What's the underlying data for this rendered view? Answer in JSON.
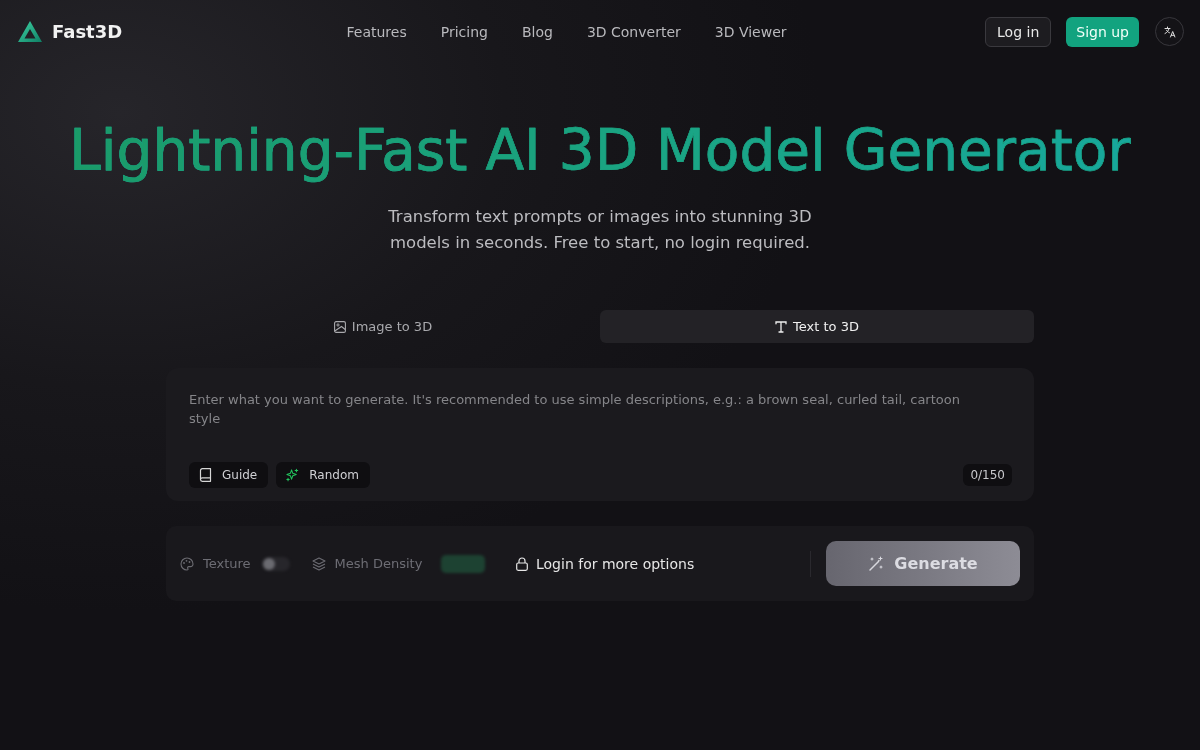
{
  "header": {
    "logo": "Fast3D",
    "nav": [
      "Features",
      "Pricing",
      "Blog",
      "3D Converter",
      "3D Viewer"
    ],
    "login": "Log in",
    "signup": "Sign up"
  },
  "hero": {
    "title": "Lightning-Fast AI 3D Model Generator",
    "subtitle": "Transform text prompts or images into stunning 3D models in seconds. Free to start, no login required."
  },
  "mode_tabs": [
    {
      "label": "Image to 3D",
      "kind": "image",
      "selected": false
    },
    {
      "label": "Text to 3D",
      "kind": "text",
      "selected": true
    }
  ],
  "prompt": {
    "placeholder": "Enter what you want to generate. It's recommended to use simple descriptions, e.g.: a brown seal, curled tail, cartoon style",
    "buttons": [
      {
        "label": "Guide",
        "kind": "guide"
      },
      {
        "label": "Random",
        "kind": "random"
      }
    ],
    "counter": "0/150"
  },
  "options": {
    "locked": true,
    "items": [
      {
        "label": "Texture",
        "kind": "toggle",
        "on": false
      },
      {
        "label": "Mesh Density",
        "kind": "pill"
      }
    ],
    "locked_message": "Login for more options",
    "generate": "Generate"
  }
}
